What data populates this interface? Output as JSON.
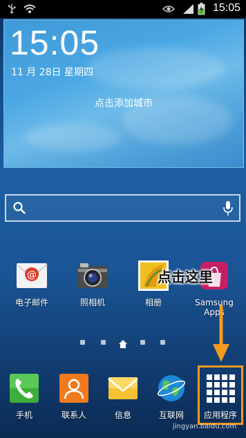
{
  "status_bar": {
    "time": "15:05",
    "icons": [
      "usb-icon",
      "wifi-icon",
      "eye-icon",
      "signal-icon",
      "battery-charging-icon"
    ]
  },
  "weather_widget": {
    "time": "15:05",
    "date": "11 月 28日 星期四",
    "city_prompt": "点击添加城市"
  },
  "search_bar": {
    "icons": [
      "search-icon",
      "microphone-icon"
    ]
  },
  "apps": [
    {
      "label": "电子邮件",
      "icon": "email-icon"
    },
    {
      "label": "照相机",
      "icon": "camera-icon"
    },
    {
      "label": "相册",
      "icon": "gallery-icon"
    },
    {
      "label": "Samsung Apps",
      "icon": "samsung-apps-icon"
    }
  ],
  "dock": [
    {
      "label": "手机",
      "icon": "phone-icon"
    },
    {
      "label": "联系人",
      "icon": "contacts-icon"
    },
    {
      "label": "信息",
      "icon": "messages-icon"
    },
    {
      "label": "互联网",
      "icon": "internet-icon"
    },
    {
      "label": "应用程序",
      "icon": "apps-grid-icon"
    }
  ],
  "annotation": {
    "text": "点击这里",
    "color": "#f49a1f"
  },
  "watermark": "jingyan.baidu.com",
  "colors": {
    "accent_orange": "#f49a1f",
    "widget_blue": "#4aa7e3"
  }
}
